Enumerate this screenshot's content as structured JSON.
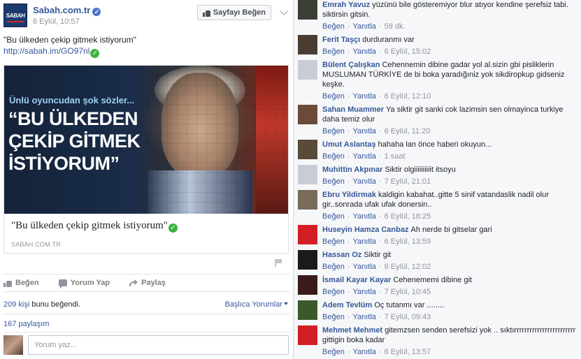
{
  "post": {
    "page_name": "Sabah.com.tr",
    "avatar_text": "SABAH",
    "time": "6 Eylül, 10:57",
    "like_page_label": "Sayfayı Beğen",
    "text": "\"Bu ülkeden çekip gitmek istiyorum\"",
    "link": "http://sabah.im/GO97nl",
    "image_caption": "Ünlü oyuncudan şok sözler...",
    "image_headline": [
      "“BU ÜLKEDEN",
      "ÇEKİP GİTMEK",
      "İSTİYORUM”"
    ],
    "card_title": "\"Bu ülkeden çekip gitmek istiyorum\"",
    "card_domain": "SABAH.COM.TR",
    "actions": {
      "like": "Beğen",
      "comment": "Yorum Yap",
      "share": "Paylaş"
    },
    "likes_count": "209 kişi",
    "likes_suffix": " bunu beğendi.",
    "sort_label": "Başlıca Yorumlar",
    "shares": "167 paylaşım",
    "comment_placeholder": "Yorum yaz..."
  },
  "comments": [
    {
      "name": "Emrah Yavuz",
      "text": "yüzünü bile gösteremiyor blur atıyor kendine şerefsiz tabi. siktirsin gitsin.",
      "like": "Beğen",
      "reply": "Yanıtla",
      "time": "59 dk.",
      "avatar": "#3a3f35"
    },
    {
      "name": "Ferit Taşçı",
      "text": "durduranmı var",
      "like": "Beğen",
      "reply": "Yanıtla",
      "time": "6 Eylül, 15:02",
      "avatar": "#4a3c30"
    },
    {
      "name": "Bülent Çalışkan",
      "text": "Cehennemin dibine gadar yol al.sizin gbi pisliklerin MUSLUMAN TÜRKİYE de bi boka yaradığıniz yok sikdiropkup gidseniz keşke.",
      "like": "Beğen",
      "reply": "Yanıtla",
      "time": "6 Eylül, 12:10",
      "avatar": "#c7ccd6"
    },
    {
      "name": "Sahan Muammer",
      "text": "Ya siktir git sanki cok lazimsin sen olmayinca turkiye daha temiz olur",
      "like": "Beğen",
      "reply": "Yanıtla",
      "time": "6 Eylül, 11:20",
      "avatar": "#6b4a3a"
    },
    {
      "name": "Umut Aslantaş",
      "text": "hahaha lan önce haberi okuyun...",
      "like": "Beğen",
      "reply": "Yanıtla",
      "time": "1 saat",
      "avatar": "#5a4a3a"
    },
    {
      "name": "Muhittin Akpınar",
      "text": "Siktir olgiiiiiiiiiit itsoyu",
      "like": "Beğen",
      "reply": "Yanıtla",
      "time": "7 Eylül, 21:01",
      "avatar": "#c7ccd6"
    },
    {
      "name": "Ebru Yildirmak",
      "text": "kaldigin kabahat..gitte 5 sinif vatandaslik nadil olur gir..sonrada ufak ufak donersin..",
      "like": "Beğen",
      "reply": "Yanıtla",
      "time": "6 Eylül, 18:25",
      "avatar": "#7a6a5a"
    },
    {
      "name": "Huseyin Hamza Canbaz",
      "text": "Ah nerde bi gitselar gari",
      "like": "Beğen",
      "reply": "Yanıtla",
      "time": "6 Eylül, 13:59",
      "avatar": "#d31e26"
    },
    {
      "name": "Hassan Oz",
      "text": "Siktir git",
      "like": "Beğen",
      "reply": "Yanıtla",
      "time": "6 Eylül, 12:02",
      "avatar": "#1a1a1a"
    },
    {
      "name": "İsmail Kayar Kayar",
      "text": "Cehenememi dibine git",
      "like": "Beğen",
      "reply": "Yanıtla",
      "time": "7 Eylül, 10:45",
      "avatar": "#3a1a1a"
    },
    {
      "name": "Adem Tevlüm",
      "text": "Oç tutanmı var ........",
      "like": "Beğen",
      "reply": "Yanıtla",
      "time": "7 Eylül, 09:43",
      "avatar": "#3a5a2a"
    },
    {
      "name": "Mehmet Mehmet",
      "text": "gitemzsen senden serefsizi yok .. sıktırrrrrrrrrrrrrrrrrrrrrrrr gittigin boka kadar",
      "like": "Beğen",
      "reply": "Yanıtla",
      "time": "6 Eylül, 13:57",
      "avatar": "#d31e26"
    }
  ]
}
